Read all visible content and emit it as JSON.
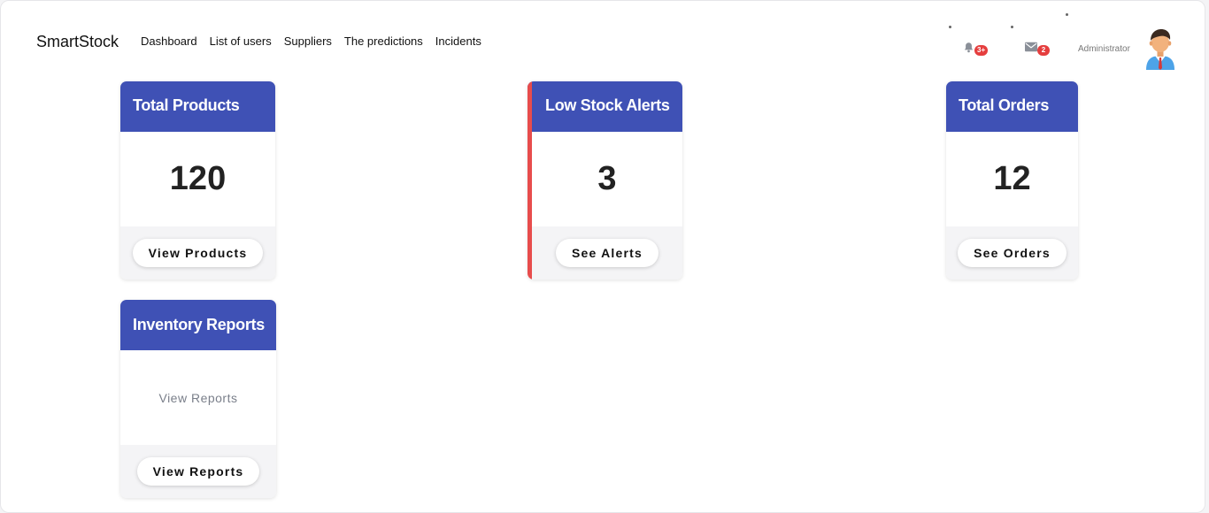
{
  "header": {
    "brand": "SmartStock",
    "nav": [
      "Dashboard",
      "List of users",
      "Suppliers",
      "The predictions",
      "Incidents"
    ],
    "notifications": {
      "icon": "bell-icon",
      "badge": "3+"
    },
    "messages": {
      "icon": "envelope-icon",
      "badge": "2"
    },
    "user_role": "Administrator"
  },
  "cards": {
    "total_products": {
      "title": "Total Products",
      "value": "120",
      "button": "View Products"
    },
    "low_stock": {
      "title": "Low Stock Alerts",
      "value": "3",
      "button": "See Alerts"
    },
    "total_orders": {
      "title": "Total Orders",
      "value": "12",
      "button": "See Orders"
    },
    "inventory_reports": {
      "title": "Inventory Reports",
      "body": "View Reports",
      "button": "View Reports"
    }
  },
  "colors": {
    "card_header": "#3f51b5",
    "alert_accent": "#e74c4c",
    "badge": "#e53e3e"
  }
}
